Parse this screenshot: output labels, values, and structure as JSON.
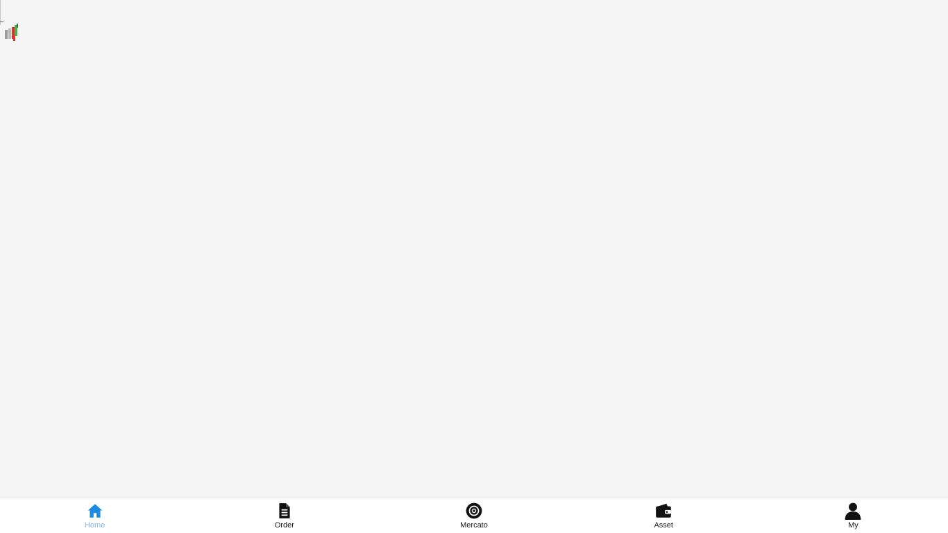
{
  "colors": {
    "background": "#f5f5f5",
    "tabbar_background": "#ffffff",
    "active_icon": "#1d8ce0",
    "active_label": "#8ab4e8",
    "inactive": "#111111"
  },
  "logo": {
    "icon": "bar-chart-logo-icon"
  },
  "tabbar": {
    "tabs": [
      {
        "label": "Home",
        "icon": "home-icon",
        "active": true
      },
      {
        "label": "Order",
        "icon": "document-icon",
        "active": false
      },
      {
        "label": "Mercato",
        "icon": "market-circle-icon",
        "active": false
      },
      {
        "label": "Asset",
        "icon": "wallet-icon",
        "active": false
      },
      {
        "label": "My",
        "icon": "user-icon",
        "active": false
      }
    ]
  }
}
